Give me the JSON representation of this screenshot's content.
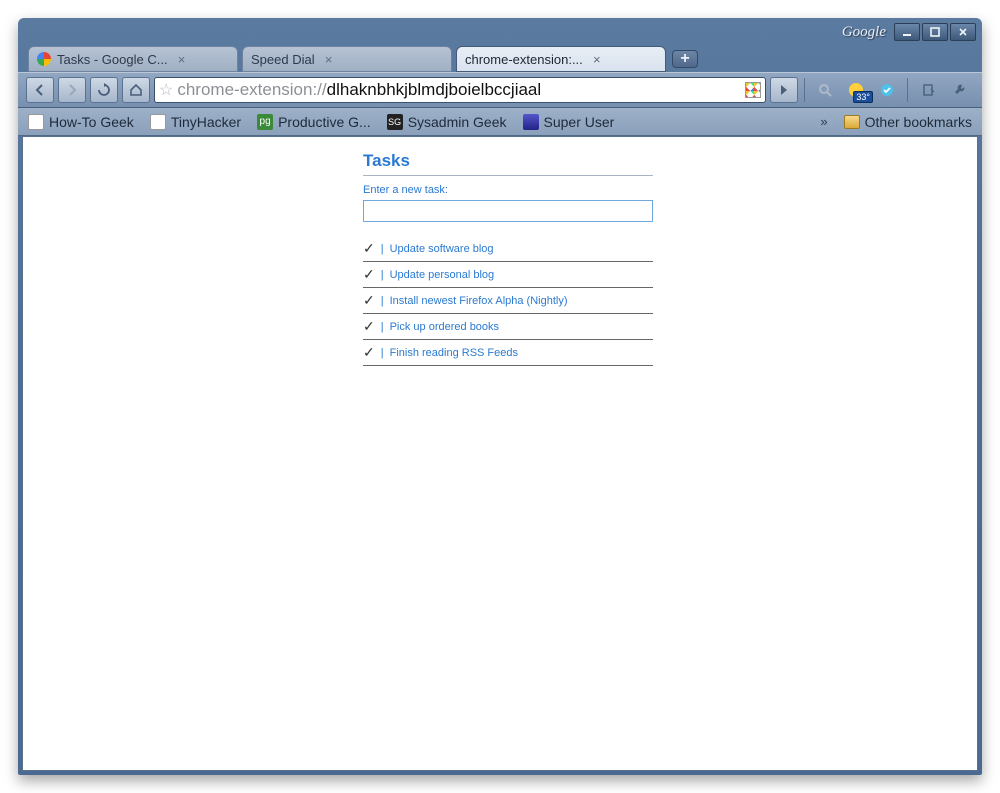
{
  "titlebar": {
    "brand": "Google"
  },
  "tabs": [
    {
      "label": "Tasks - Google C...",
      "active": false
    },
    {
      "label": "Speed Dial",
      "active": false
    },
    {
      "label": "chrome-extension:...",
      "active": true
    }
  ],
  "url": {
    "scheme": "chrome-extension://",
    "path": "dlhaknbhkjblmdjboielbccjiaal"
  },
  "bookmarks": [
    {
      "label": "How-To Geek"
    },
    {
      "label": "TinyHacker"
    },
    {
      "label": "Productive G..."
    },
    {
      "label": "Sysadmin Geek"
    },
    {
      "label": "Super User"
    }
  ],
  "other_bookmarks_label": "Other bookmarks",
  "weather_temp": "33°",
  "page": {
    "title": "Tasks",
    "new_task_label": "Enter a new task:",
    "tasks": [
      {
        "text": "Update software blog"
      },
      {
        "text": "Update personal blog"
      },
      {
        "text": "Install newest Firefox Alpha (Nightly)"
      },
      {
        "text": "Pick up ordered books"
      },
      {
        "text": "Finish reading RSS Feeds"
      }
    ]
  }
}
